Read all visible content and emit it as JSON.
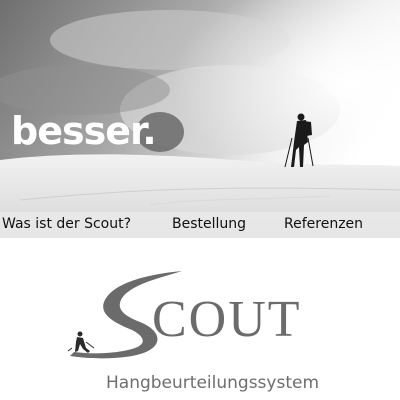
{
  "hero": {
    "tagline": "besser."
  },
  "nav": {
    "items": [
      {
        "label": "Was ist der Scout?"
      },
      {
        "label": "Bestellung"
      },
      {
        "label": "Referenzen"
      }
    ]
  },
  "logo": {
    "brand_rest": "COUT",
    "subtitle": "Hangbeurteilungssystem",
    "color": "#6b6b6b"
  }
}
